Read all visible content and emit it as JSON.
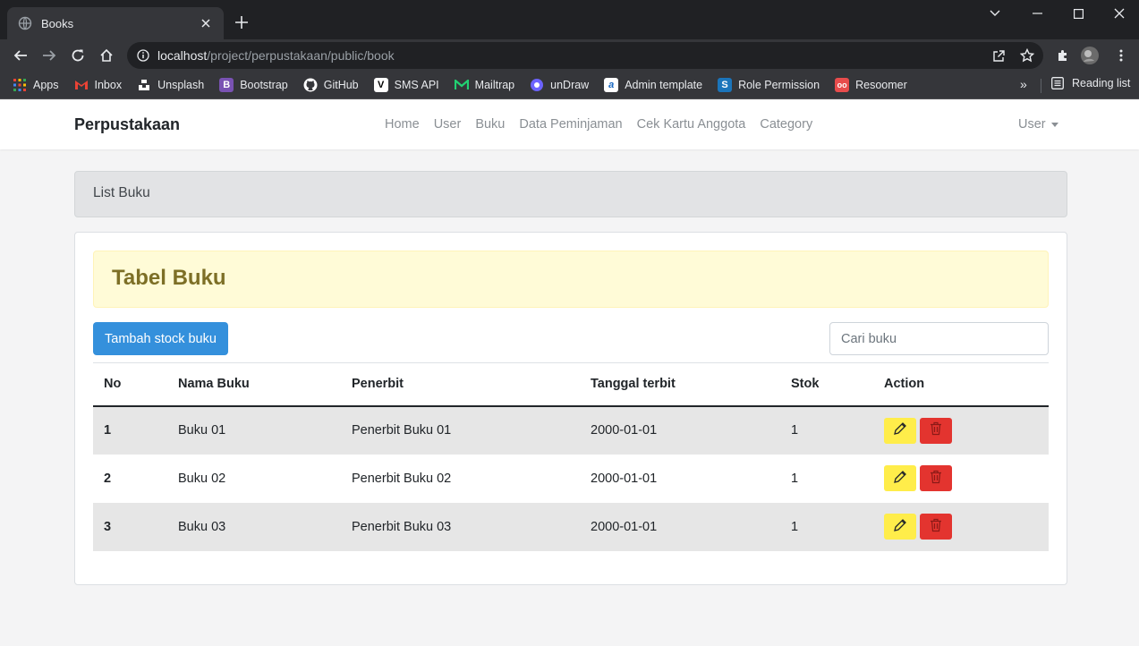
{
  "browser": {
    "tab_title": "Books",
    "url_host": "localhost",
    "url_path": "/project/perpustakaan/public/book",
    "bookmarks": [
      {
        "label": "Apps",
        "icon": "apps-grid-icon",
        "color": "#4285f4"
      },
      {
        "label": "Inbox",
        "icon": "gmail-icon",
        "color": "#ea4335"
      },
      {
        "label": "Unsplash",
        "icon": "unsplash-icon",
        "color": "#ffffff"
      },
      {
        "label": "Bootstrap",
        "icon": "bootstrap-icon",
        "color": "#7952b3"
      },
      {
        "label": "GitHub",
        "icon": "github-icon",
        "color": "#ffffff"
      },
      {
        "label": "SMS API",
        "icon": "vonage-icon",
        "color": "#ffffff"
      },
      {
        "label": "Mailtrap",
        "icon": "mailtrap-icon",
        "color": "#22d172"
      },
      {
        "label": "unDraw",
        "icon": "undraw-icon",
        "color": "#6c63ff"
      },
      {
        "label": "Admin template",
        "icon": "admin-template-icon",
        "color": "#5e72e4"
      },
      {
        "label": "Role Permission",
        "icon": "role-permission-icon",
        "color": "#1b75bb"
      },
      {
        "label": "Resoomer",
        "icon": "resoomer-icon",
        "color": "#e84c4c"
      }
    ],
    "reading_list": "Reading list"
  },
  "navbar": {
    "brand": "Perpustakaan",
    "links": [
      "Home",
      "User",
      "Buku",
      "Data Peminjaman",
      "Cek Kartu Anggota",
      "Category"
    ],
    "user_menu": "User"
  },
  "breadcrumb": "List Buku",
  "card": {
    "alert_title": "Tabel Buku",
    "add_button": "Tambah stock buku",
    "search_placeholder": "Cari buku"
  },
  "table": {
    "headers": [
      "No",
      "Nama Buku",
      "Penerbit",
      "Tanggal terbit",
      "Stok",
      "Action"
    ],
    "rows": [
      {
        "no": "1",
        "nama": "Buku 01",
        "penerbit": "Penerbit Buku 01",
        "tanggal": "2000-01-01",
        "stok": "1"
      },
      {
        "no": "2",
        "nama": "Buku 02",
        "penerbit": "Penerbit Buku 02",
        "tanggal": "2000-01-01",
        "stok": "1"
      },
      {
        "no": "3",
        "nama": "Buku 03",
        "penerbit": "Penerbit Buku 03",
        "tanggal": "2000-01-01",
        "stok": "1"
      }
    ]
  },
  "colors": {
    "primary": "#3490dc",
    "warning": "#ffed4a",
    "danger": "#e3342f",
    "alert_bg": "#fffbd7",
    "alert_text": "#7d6f26"
  }
}
